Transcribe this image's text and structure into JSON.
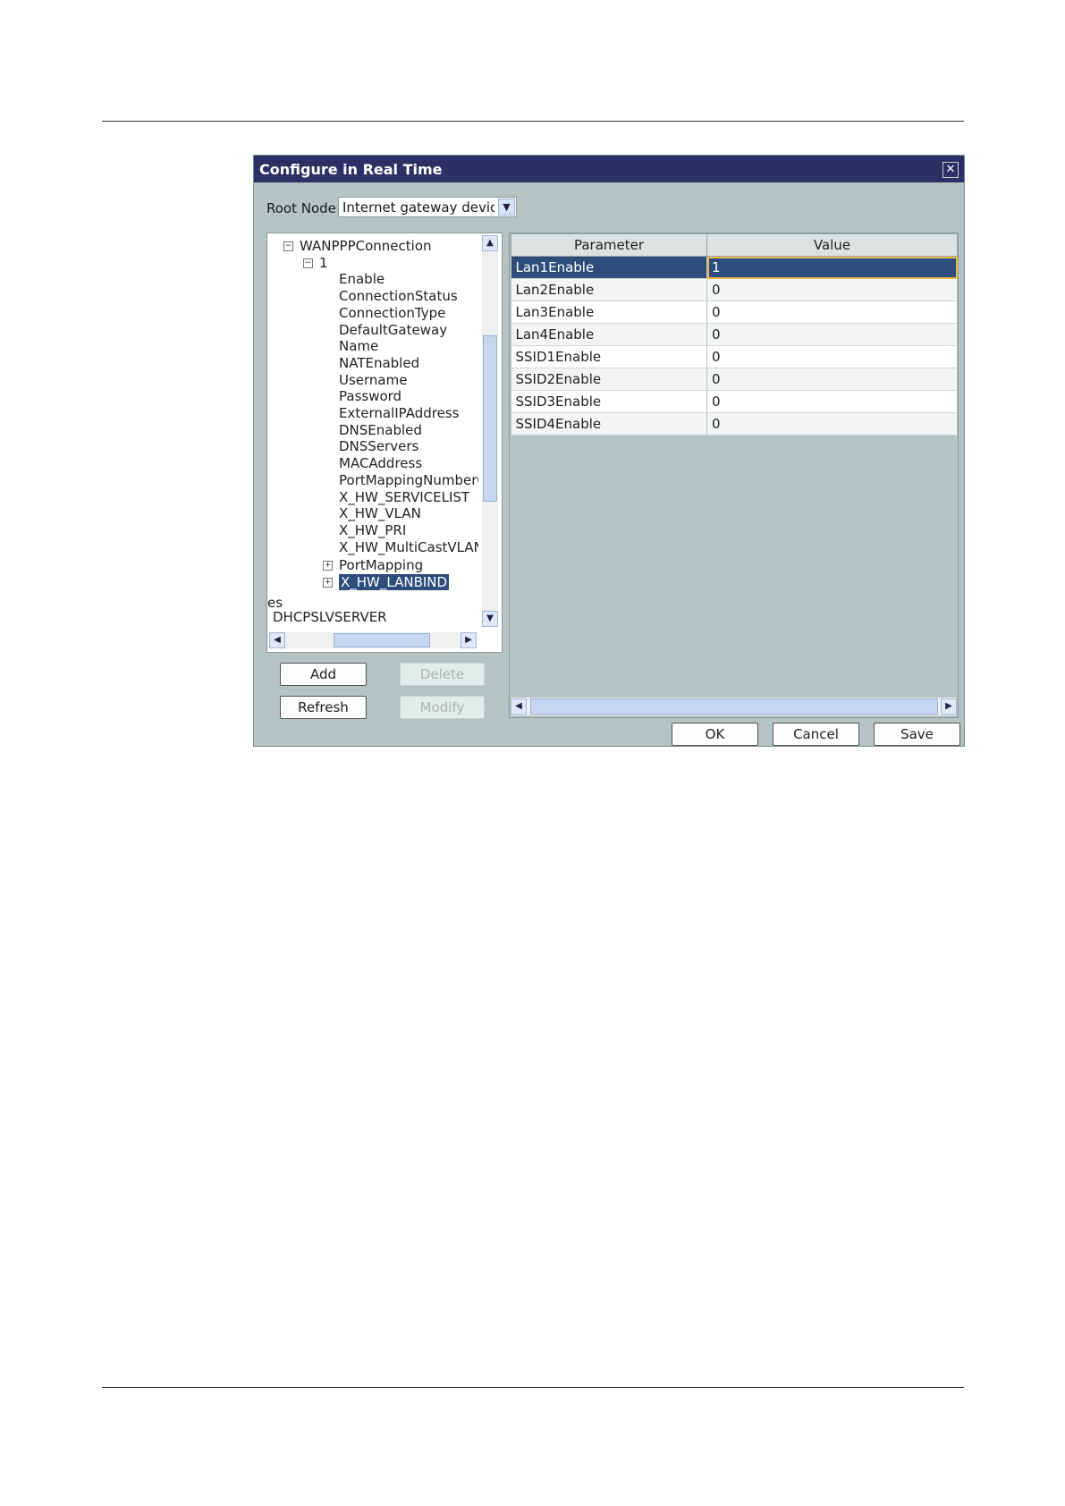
{
  "dialog": {
    "title": "Configure in Real Time",
    "close_label": "✕"
  },
  "root_node": {
    "label": "Root Node",
    "value": "Internet gateway device"
  },
  "tree": {
    "nodes": [
      {
        "label": "WANPPPConnection",
        "expander": "−"
      },
      {
        "label": "1",
        "expander": "−"
      },
      {
        "label": "Enable"
      },
      {
        "label": "ConnectionStatus"
      },
      {
        "label": "ConnectionType"
      },
      {
        "label": "DefaultGateway"
      },
      {
        "label": "Name"
      },
      {
        "label": "NATEnabled"
      },
      {
        "label": "Username"
      },
      {
        "label": "Password"
      },
      {
        "label": "ExternalIPAddress"
      },
      {
        "label": "DNSEnabled"
      },
      {
        "label": "DNSServers"
      },
      {
        "label": "MACAddress"
      },
      {
        "label": "PortMappingNumberOfEntries"
      },
      {
        "label": "X_HW_SERVICELIST"
      },
      {
        "label": "X_HW_VLAN"
      },
      {
        "label": "X_HW_PRI"
      },
      {
        "label": "X_HW_MultiCastVLAN"
      },
      {
        "label": "PortMapping",
        "expander": "+"
      },
      {
        "label": "X_HW_LANBIND",
        "expander": "+"
      },
      {
        "label": "es"
      },
      {
        "label": "DHCPSLVSERVER"
      }
    ]
  },
  "buttons": {
    "add": "Add",
    "delete": "Delete",
    "refresh": "Refresh",
    "modify": "Modify",
    "ok": "OK",
    "cancel": "Cancel",
    "save": "Save"
  },
  "grid": {
    "headers": {
      "parameter": "Parameter",
      "value": "Value"
    },
    "rows": [
      {
        "parameter": "Lan1Enable",
        "value": "1"
      },
      {
        "parameter": "Lan2Enable",
        "value": "0"
      },
      {
        "parameter": "Lan3Enable",
        "value": "0"
      },
      {
        "parameter": "Lan4Enable",
        "value": "0"
      },
      {
        "parameter": "SSID1Enable",
        "value": "0"
      },
      {
        "parameter": "SSID2Enable",
        "value": "0"
      },
      {
        "parameter": "SSID3Enable",
        "value": "0"
      },
      {
        "parameter": "SSID4Enable",
        "value": "0"
      }
    ]
  },
  "colors": {
    "titlebar": "#2c3065",
    "dialog_bg": "#b5c4c3",
    "selection": "#2d4e7d",
    "focus_outline": "#e8b84a"
  }
}
